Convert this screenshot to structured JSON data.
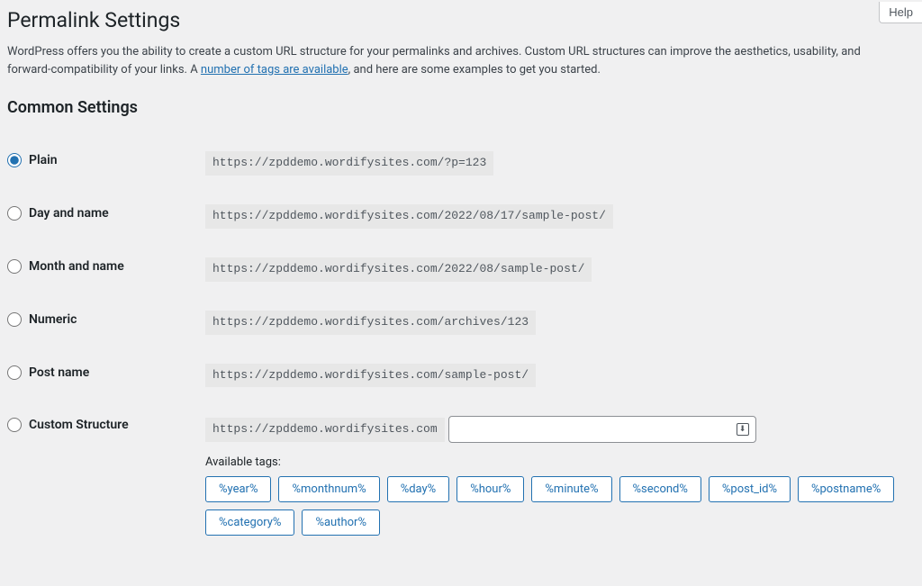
{
  "header": {
    "help_label": "Help"
  },
  "page": {
    "title": "Permalink Settings",
    "intro_before": "WordPress offers you the ability to create a custom URL structure for your permalinks and archives. Custom URL structures can improve the aesthetics, usability, and forward-compatibility of your links. A ",
    "intro_link": "number of tags are available",
    "intro_after": ", and here are some examples to get you started."
  },
  "common": {
    "heading": "Common Settings",
    "options": [
      {
        "key": "plain",
        "label": "Plain",
        "url": "https://zpddemo.wordifysites.com/?p=123",
        "checked": true
      },
      {
        "key": "day-name",
        "label": "Day and name",
        "url": "https://zpddemo.wordifysites.com/2022/08/17/sample-post/",
        "checked": false
      },
      {
        "key": "month-name",
        "label": "Month and name",
        "url": "https://zpddemo.wordifysites.com/2022/08/sample-post/",
        "checked": false
      },
      {
        "key": "numeric",
        "label": "Numeric",
        "url": "https://zpddemo.wordifysites.com/archives/123",
        "checked": false
      },
      {
        "key": "post-name",
        "label": "Post name",
        "url": "https://zpddemo.wordifysites.com/sample-post/",
        "checked": false
      }
    ],
    "custom": {
      "label": "Custom Structure",
      "base_url": "https://zpddemo.wordifysites.com",
      "input_value": "",
      "available_label": "Available tags:",
      "tags": [
        "%year%",
        "%monthnum%",
        "%day%",
        "%hour%",
        "%minute%",
        "%second%",
        "%post_id%",
        "%postname%",
        "%category%",
        "%author%"
      ]
    }
  }
}
